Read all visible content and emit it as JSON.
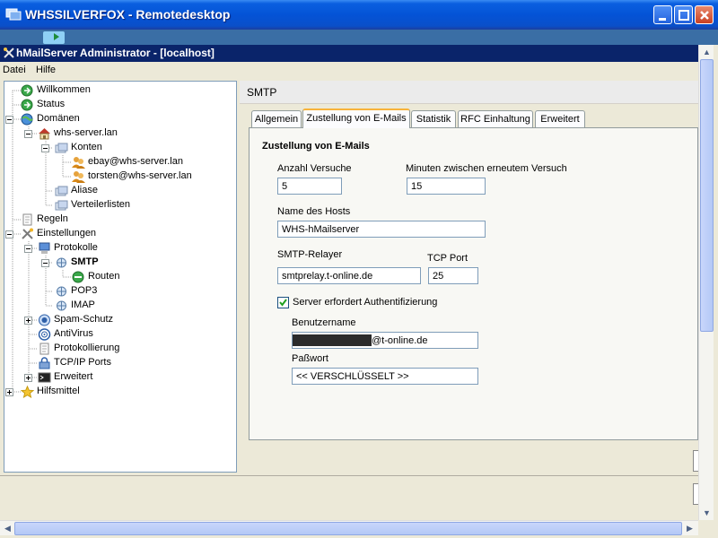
{
  "window": {
    "title": "WHSSILVERFOX - Remotedesktop"
  },
  "app": {
    "title": "hMailServer Administrator - [localhost]"
  },
  "menu": {
    "items": [
      "Datei",
      "Hilfe"
    ]
  },
  "tree": {
    "items": [
      {
        "label": "Willkommen",
        "icon": "green-arrow-icon"
      },
      {
        "label": "Status",
        "icon": "green-arrow-icon"
      },
      {
        "label": "Domänen",
        "icon": "globe-icon"
      },
      {
        "label": "whs-server.lan",
        "icon": "house-icon"
      },
      {
        "label": "Konten",
        "icon": "users-icon"
      },
      {
        "label": "ebay@whs-server.lan",
        "icon": "user-icon"
      },
      {
        "label": "torsten@whs-server.lan",
        "icon": "user-icon"
      },
      {
        "label": "Aliase",
        "icon": "users-icon"
      },
      {
        "label": "Verteilerlisten",
        "icon": "users-icon"
      },
      {
        "label": "Regeln",
        "icon": "document-icon"
      },
      {
        "label": "Einstellungen",
        "icon": "tools-icon"
      },
      {
        "label": "Protokolle",
        "icon": "computer-icon"
      },
      {
        "label": "SMTP",
        "icon": "network-icon"
      },
      {
        "label": "Routen",
        "icon": "green-route-icon"
      },
      {
        "label": "POP3",
        "icon": "network-icon"
      },
      {
        "label": "IMAP",
        "icon": "network-icon"
      },
      {
        "label": "Spam-Schutz",
        "icon": "shield-icon"
      },
      {
        "label": "AntiVirus",
        "icon": "target-icon"
      },
      {
        "label": "Protokollierung",
        "icon": "document-icon"
      },
      {
        "label": "TCP/IP Ports",
        "icon": "lock-icon"
      },
      {
        "label": "Erweitert",
        "icon": "console-icon"
      },
      {
        "label": "Hilfsmittel",
        "icon": "star-icon"
      }
    ]
  },
  "pane": {
    "title": "SMTP",
    "tabs": [
      "Allgemein",
      "Zustellung von E-Mails",
      "Statistik",
      "RFC Einhaltung",
      "Erweitert"
    ],
    "active_tab": "Zustellung von E-Mails",
    "section_title": "Zustellung von E-Mails",
    "fields": {
      "attempts_label": "Anzahl Versuche",
      "attempts_value": "5",
      "minutes_label": "Minuten zwischen erneutem Versuch",
      "minutes_value": "15",
      "hostname_label": "Name des Hosts",
      "hostname_value": "WHS-hMailserver",
      "relayer_label": "SMTP-Relayer",
      "relayer_value": "smtprelay.t-online.de",
      "port_label": "TCP Port",
      "port_value": "25",
      "auth_label": "Server erfordert Authentifizierung",
      "auth_checked": true,
      "username_label": "Benutzername",
      "username_suffix": "@t-online.de",
      "password_label": "Paßwort",
      "password_value": "<< VERSCHLÜSSELT >>"
    }
  }
}
